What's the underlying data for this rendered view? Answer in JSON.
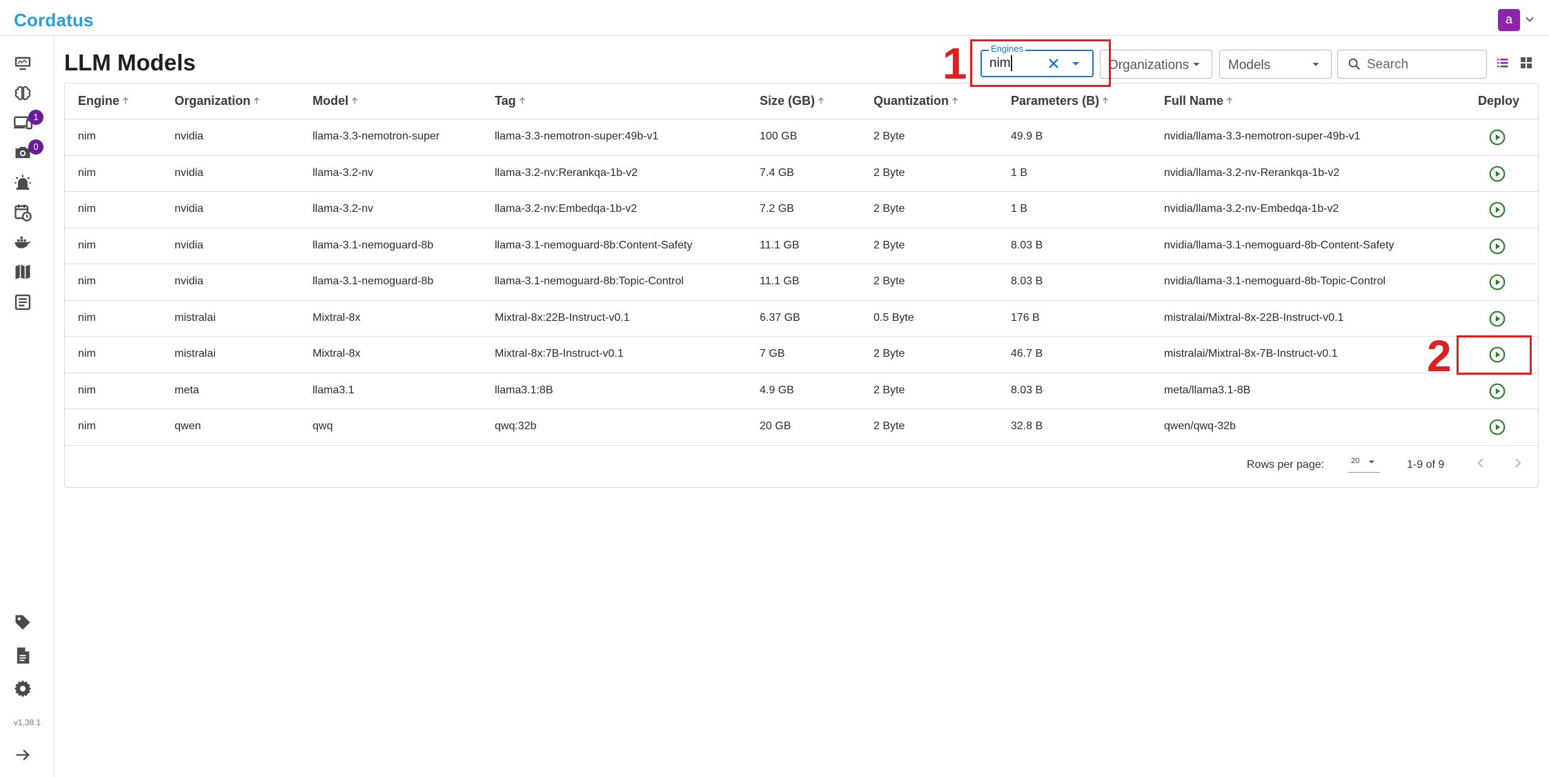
{
  "app": {
    "brand": "Cordatus",
    "avatar_letter": "a",
    "version": "v1.38.1"
  },
  "sidebar": {
    "items": [
      {
        "name": "monitor-icon"
      },
      {
        "name": "brain-icon"
      },
      {
        "name": "devices-icon",
        "badge": "1"
      },
      {
        "name": "camera-icon",
        "badge": "0"
      },
      {
        "name": "alarm-icon"
      },
      {
        "name": "schedule-icon"
      },
      {
        "name": "docker-icon"
      },
      {
        "name": "map-icon"
      },
      {
        "name": "article-icon"
      },
      {
        "name": "tag-icon"
      },
      {
        "name": "document-icon"
      },
      {
        "name": "settings-icon"
      },
      {
        "name": "collapse-arrow-icon"
      }
    ]
  },
  "page": {
    "title": "LLM Models"
  },
  "filters": {
    "engines": {
      "label": "Engines",
      "value": "nim"
    },
    "organizations": {
      "label": "Organizations"
    },
    "models": {
      "label": "Models"
    },
    "search": {
      "placeholder": "Search"
    }
  },
  "annotations": [
    {
      "label": "1"
    },
    {
      "label": "2"
    }
  ],
  "table": {
    "columns": [
      "Engine",
      "Organization",
      "Model",
      "Tag",
      "Size (GB)",
      "Quantization",
      "Parameters (B)",
      "Full Name",
      "Deploy"
    ],
    "rows": [
      {
        "engine": "nim",
        "organization": "nvidia",
        "model": "llama-3.3-nemotron-super",
        "tag": "llama-3.3-nemotron-super:49b-v1",
        "size": "100 GB",
        "quantization": "2 Byte",
        "parameters": "49.9 B",
        "full_name": "nvidia/llama-3.3-nemotron-super-49b-v1"
      },
      {
        "engine": "nim",
        "organization": "nvidia",
        "model": "llama-3.2-nv",
        "tag": "llama-3.2-nv:Rerankqa-1b-v2",
        "size": "7.4 GB",
        "quantization": "2 Byte",
        "parameters": "1 B",
        "full_name": "nvidia/llama-3.2-nv-Rerankqa-1b-v2"
      },
      {
        "engine": "nim",
        "organization": "nvidia",
        "model": "llama-3.2-nv",
        "tag": "llama-3.2-nv:Embedqa-1b-v2",
        "size": "7.2 GB",
        "quantization": "2 Byte",
        "parameters": "1 B",
        "full_name": "nvidia/llama-3.2-nv-Embedqa-1b-v2"
      },
      {
        "engine": "nim",
        "organization": "nvidia",
        "model": "llama-3.1-nemoguard-8b",
        "tag": "llama-3.1-nemoguard-8b:Content-Safety",
        "size": "11.1 GB",
        "quantization": "2 Byte",
        "parameters": "8.03 B",
        "full_name": "nvidia/llama-3.1-nemoguard-8b-Content-Safety"
      },
      {
        "engine": "nim",
        "organization": "nvidia",
        "model": "llama-3.1-nemoguard-8b",
        "tag": "llama-3.1-nemoguard-8b:Topic-Control",
        "size": "11.1 GB",
        "quantization": "2 Byte",
        "parameters": "8.03 B",
        "full_name": "nvidia/llama-3.1-nemoguard-8b-Topic-Control"
      },
      {
        "engine": "nim",
        "organization": "mistralai",
        "model": "Mixtral-8x",
        "tag": "Mixtral-8x:22B-Instruct-v0.1",
        "size": "6.37 GB",
        "quantization": "0.5 Byte",
        "parameters": "176 B",
        "full_name": "mistralai/Mixtral-8x-22B-Instruct-v0.1"
      },
      {
        "engine": "nim",
        "organization": "mistralai",
        "model": "Mixtral-8x",
        "tag": "Mixtral-8x:7B-Instruct-v0.1",
        "size": "7 GB",
        "quantization": "2 Byte",
        "parameters": "46.7 B",
        "full_name": "mistralai/Mixtral-8x-7B-Instruct-v0.1"
      },
      {
        "engine": "nim",
        "organization": "meta",
        "model": "llama3.1",
        "tag": "llama3.1:8B",
        "size": "4.9 GB",
        "quantization": "2 Byte",
        "parameters": "8.03 B",
        "full_name": "meta/llama3.1-8B"
      },
      {
        "engine": "nim",
        "organization": "qwen",
        "model": "qwq",
        "tag": "qwq:32b",
        "size": "20 GB",
        "quantization": "2 Byte",
        "parameters": "32.8 B",
        "full_name": "qwen/qwq-32b"
      }
    ]
  },
  "pagination": {
    "rows_per_page_label": "Rows per page:",
    "rows_per_page": "20",
    "range": "1-9 of 9"
  },
  "colors": {
    "brand": "#2a9fd6",
    "accent": "#1976d2",
    "deploy": "#2e7d32",
    "badge": "#6a1b9a",
    "avatar": "#8e24aa",
    "annotation": "#e02020"
  }
}
